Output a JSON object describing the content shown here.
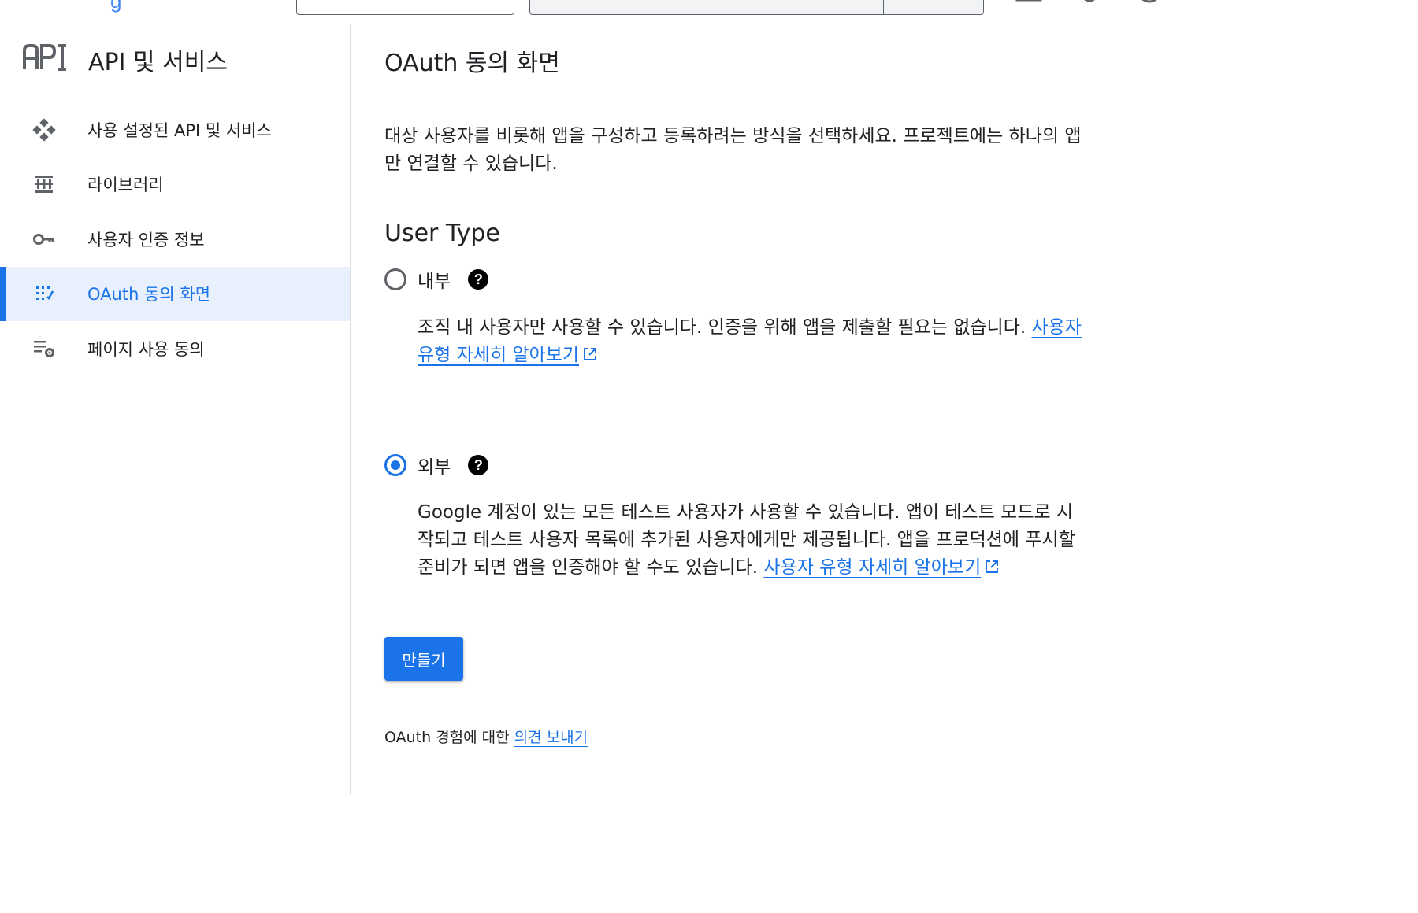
{
  "colors": {
    "accent": "#1a73e8",
    "active_bg": "#e8f0fe",
    "text": "#202124",
    "icon_gray": "#5f6368"
  },
  "sidebar": {
    "logo_icon": "api-logo-icon",
    "title": "API 및 서비스",
    "items": [
      {
        "label": "사용 설정된 API 및 서비스",
        "icon": "enabled-apis-icon",
        "active": false
      },
      {
        "label": "라이브러리",
        "icon": "library-icon",
        "active": false
      },
      {
        "label": "사용자 인증 정보",
        "icon": "key-icon",
        "active": false
      },
      {
        "label": "OAuth 동의 화면",
        "icon": "oauth-consent-icon",
        "active": true
      },
      {
        "label": "페이지 사용 동의",
        "icon": "settings-list-icon",
        "active": false
      }
    ]
  },
  "main": {
    "title": "OAuth 동의 화면",
    "intro": "대상 사용자를 비롯해 앱을 구성하고 등록하려는 방식을 선택하세요. 프로젝트에는 하나의 앱만 연결할 수 있습니다.",
    "user_type": {
      "heading": "User Type",
      "options": [
        {
          "label": "내부",
          "checked": false,
          "description": "조직 내 사용자만 사용할 수 있습니다. 인증을 위해 앱을 제출할 필요는 없습니다. ",
          "link": "사용자 유형 자세히 알아보기"
        },
        {
          "label": "외부",
          "checked": true,
          "description": "Google 계정이 있는 모든 테스트 사용자가 사용할 수 있습니다. 앱이 테스트 모드로 시작되고 테스트 사용자 목록에 추가된 사용자에게만 제공됩니다. 앱을 프로덕션에 푸시할 준비가 되면 앱을 인증해야 할 수도 있습니다. ",
          "link": "사용자 유형 자세히 알아보기"
        }
      ]
    },
    "create_button": "만들기",
    "feedback_prefix": "OAuth 경험에 대한 ",
    "feedback_link": "의견 보내기"
  }
}
